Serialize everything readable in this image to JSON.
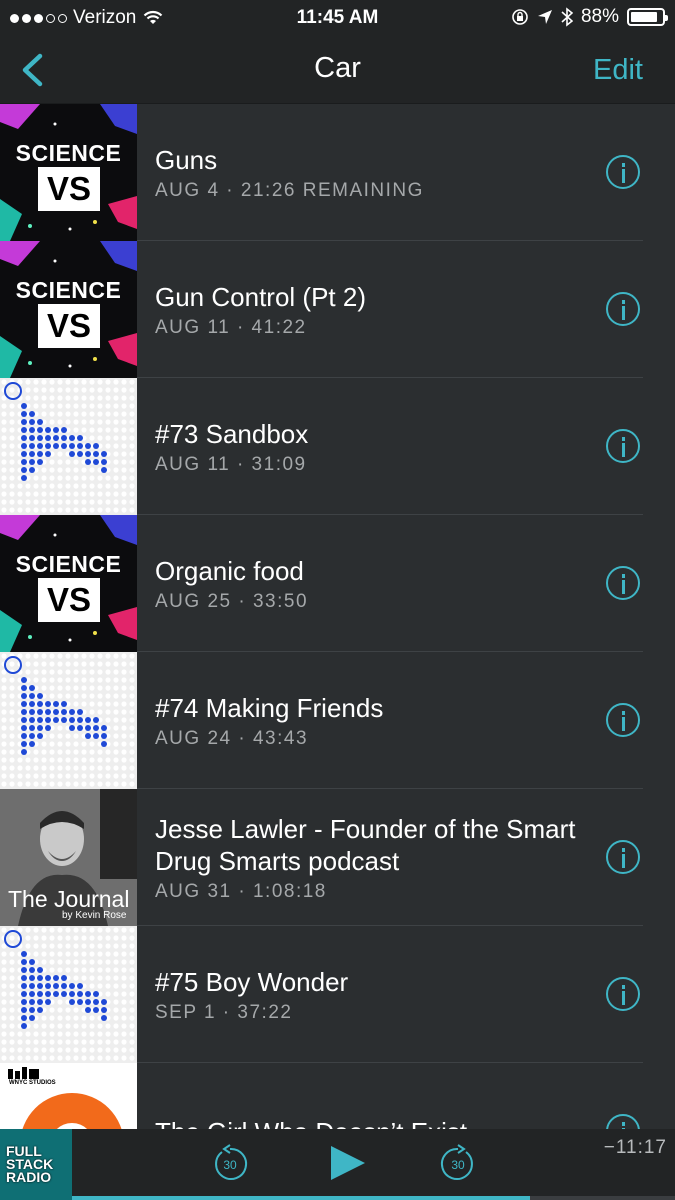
{
  "status_bar": {
    "carrier": "Verizon",
    "time": "11:45 AM",
    "battery": "88%",
    "battery_level": 0.88,
    "signal_bars": 3
  },
  "nav": {
    "title": "Car",
    "edit_label": "Edit",
    "back_icon": "chevron-left-icon"
  },
  "colors": {
    "accent": "#3fb6c6",
    "background": "#2b2e30",
    "bar": "#222425",
    "meta_text": "#a5a8aa"
  },
  "episodes": [
    {
      "title": "Guns",
      "meta": "AUG 4 · 21:26 REMAINING",
      "art": "science-vs"
    },
    {
      "title": "Gun Control (Pt 2)",
      "meta": "AUG 11 · 41:22",
      "art": "science-vs"
    },
    {
      "title": "#73 Sandbox",
      "meta": "AUG 11 · 31:09",
      "art": "sandbox"
    },
    {
      "title": "Organic food",
      "meta": "AUG 25 · 33:50",
      "art": "science-vs"
    },
    {
      "title": "#74 Making Friends",
      "meta": "AUG 24 · 43:43",
      "art": "sandbox"
    },
    {
      "title": "Jesse Lawler - Founder of the Smart Drug Smarts podcast",
      "meta": "AUG 31 · 1:08:18",
      "art": "the-journal"
    },
    {
      "title": "#75 Boy Wonder",
      "meta": "SEP 1 · 37:22",
      "art": "sandbox"
    },
    {
      "title": "The Girl Who Doesn’t Exist",
      "meta": "",
      "art": "wnyc"
    }
  ],
  "artwork_text": {
    "science": "SCIENCE",
    "vs": "VS",
    "journal": "The Journal",
    "journal_by": "by Kevin Rose",
    "wnyc": "WNYC STUDIOS",
    "full_stack": "FULL STACK RADIO"
  },
  "player": {
    "skip_back_label": "30",
    "skip_forward_label": "30",
    "remaining": "−11:17",
    "progress": 0.76,
    "play_icon": "play-icon"
  }
}
